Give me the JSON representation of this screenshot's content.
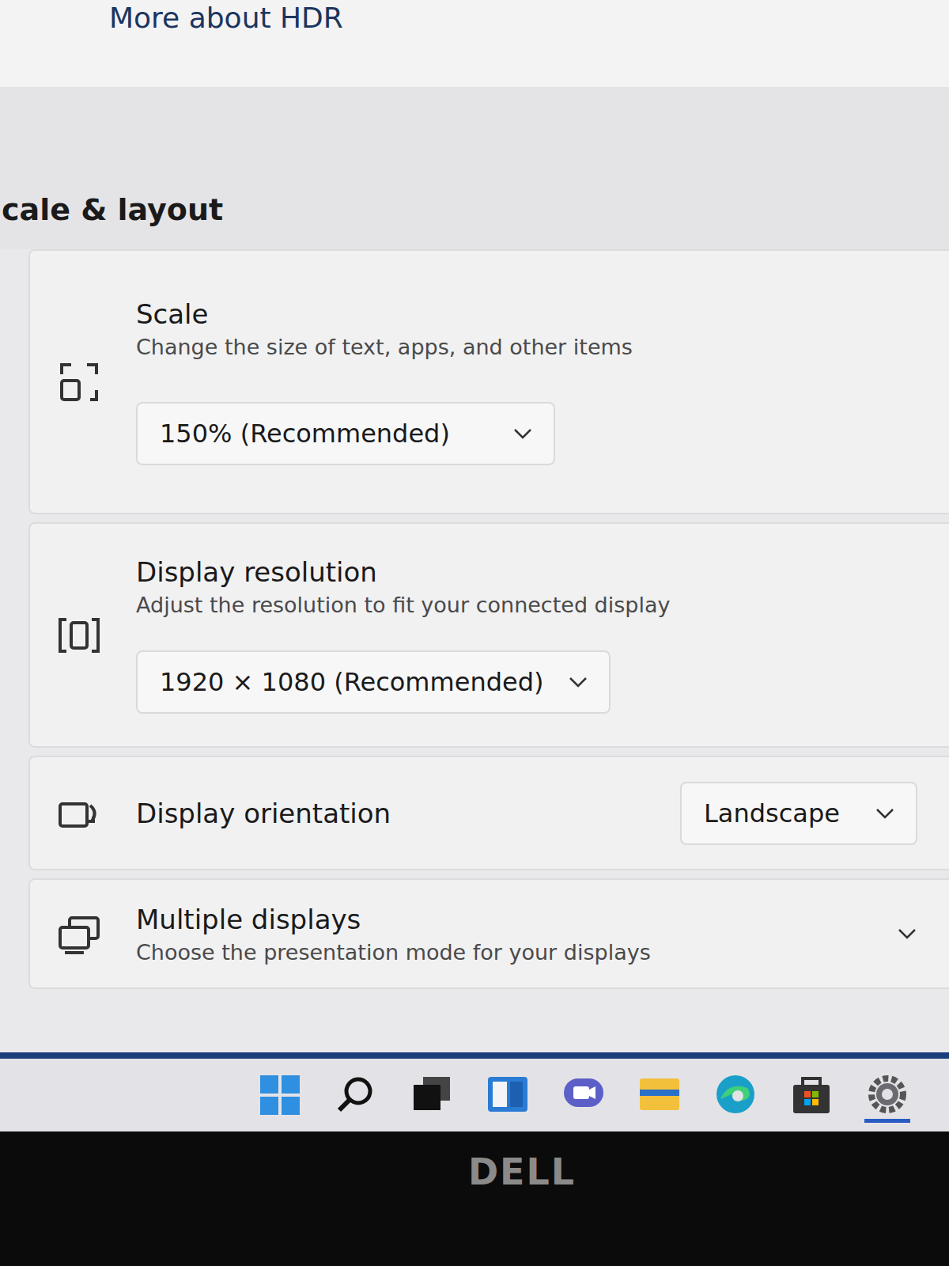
{
  "header": {
    "link": "More about HDR"
  },
  "section": {
    "title": "cale & layout"
  },
  "settings": [
    {
      "kind": "dropdown-below",
      "title": "Scale",
      "description": "Change the size of text, apps, and other items",
      "value": "150% (Recommended)"
    },
    {
      "kind": "dropdown-below",
      "title": "Display resolution",
      "description": "Adjust the resolution to fit your connected display",
      "value": "1920 × 1080 (Recommended)"
    },
    {
      "kind": "dropdown-inline",
      "title": "Display orientation",
      "value": "Landscape"
    },
    {
      "kind": "expander",
      "title": "Multiple displays",
      "description": "Choose the presentation mode for your displays",
      "expanded": false
    }
  ],
  "taskbar": {
    "items": [
      {
        "selected": false
      },
      {
        "selected": false
      },
      {
        "selected": false
      },
      {
        "selected": false
      },
      {
        "selected": false
      },
      {
        "selected": false
      },
      {
        "selected": false
      },
      {
        "selected": false
      },
      {
        "selected": true
      }
    ]
  },
  "bezel": {
    "logo": "DELL"
  }
}
